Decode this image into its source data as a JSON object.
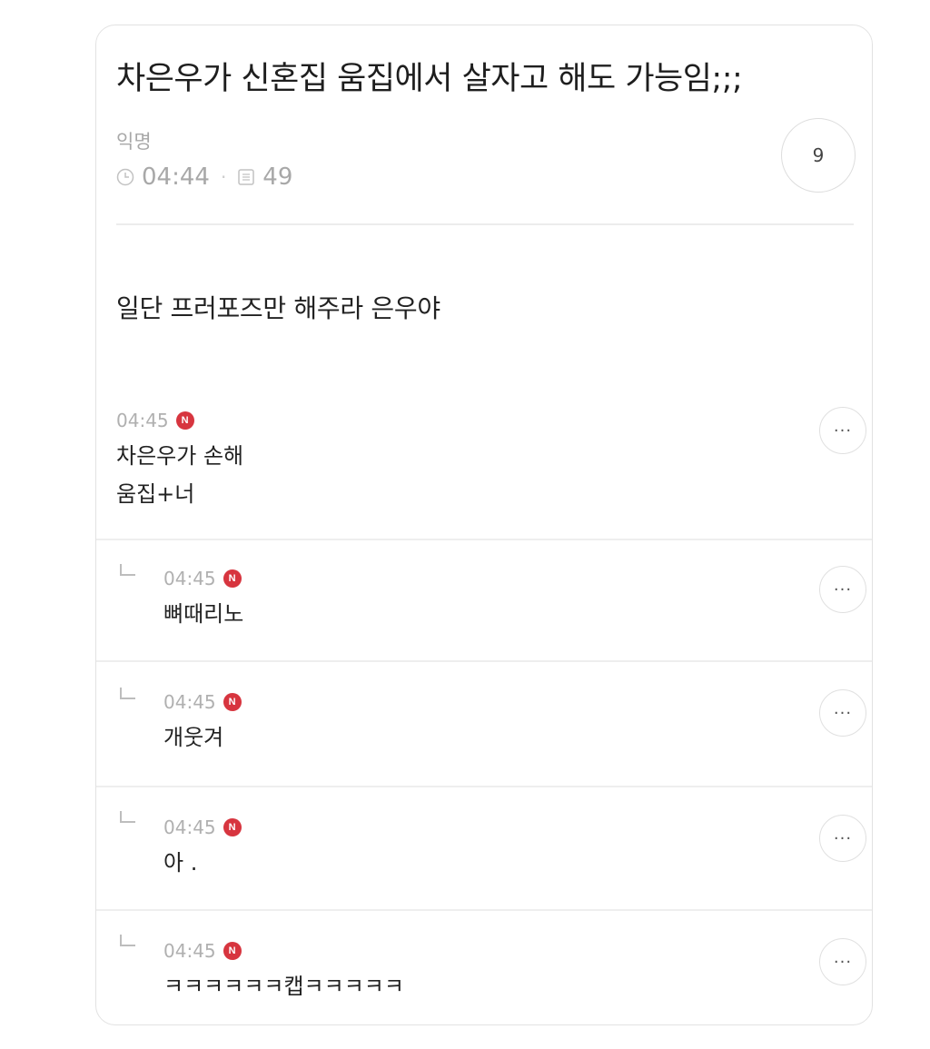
{
  "post": {
    "title": "차은우가 신혼집 움집에서 살자고 해도 가능임;;;",
    "author": "익명",
    "time": "04:44",
    "views": "49",
    "comment_count": "9",
    "body": "일단 프러포즈만 해주라 은우야"
  },
  "comments": [
    {
      "time": "04:45",
      "badge": "N",
      "text": "차은우가 손해\n움집+너",
      "reply": false
    },
    {
      "time": "04:45",
      "badge": "N",
      "text": "뼈때리노",
      "reply": true
    },
    {
      "time": "04:45",
      "badge": "N",
      "text": "개웃겨",
      "reply": true
    },
    {
      "time": "04:45",
      "badge": "N",
      "text": "아 .",
      "reply": true
    },
    {
      "time": "04:45",
      "badge": "N",
      "text": "ㅋㅋㅋㅋㅋㅋ캡ㅋㅋㅋㅋㅋ",
      "reply": true
    }
  ],
  "more_label": "···",
  "colors": {
    "new_badge": "#d7353f",
    "muted": "#a8a8a8",
    "text": "#222222"
  },
  "icons": {
    "time": "clock-icon",
    "views": "views-icon",
    "reply": "reply-arrow-icon",
    "more": "more-icon"
  }
}
